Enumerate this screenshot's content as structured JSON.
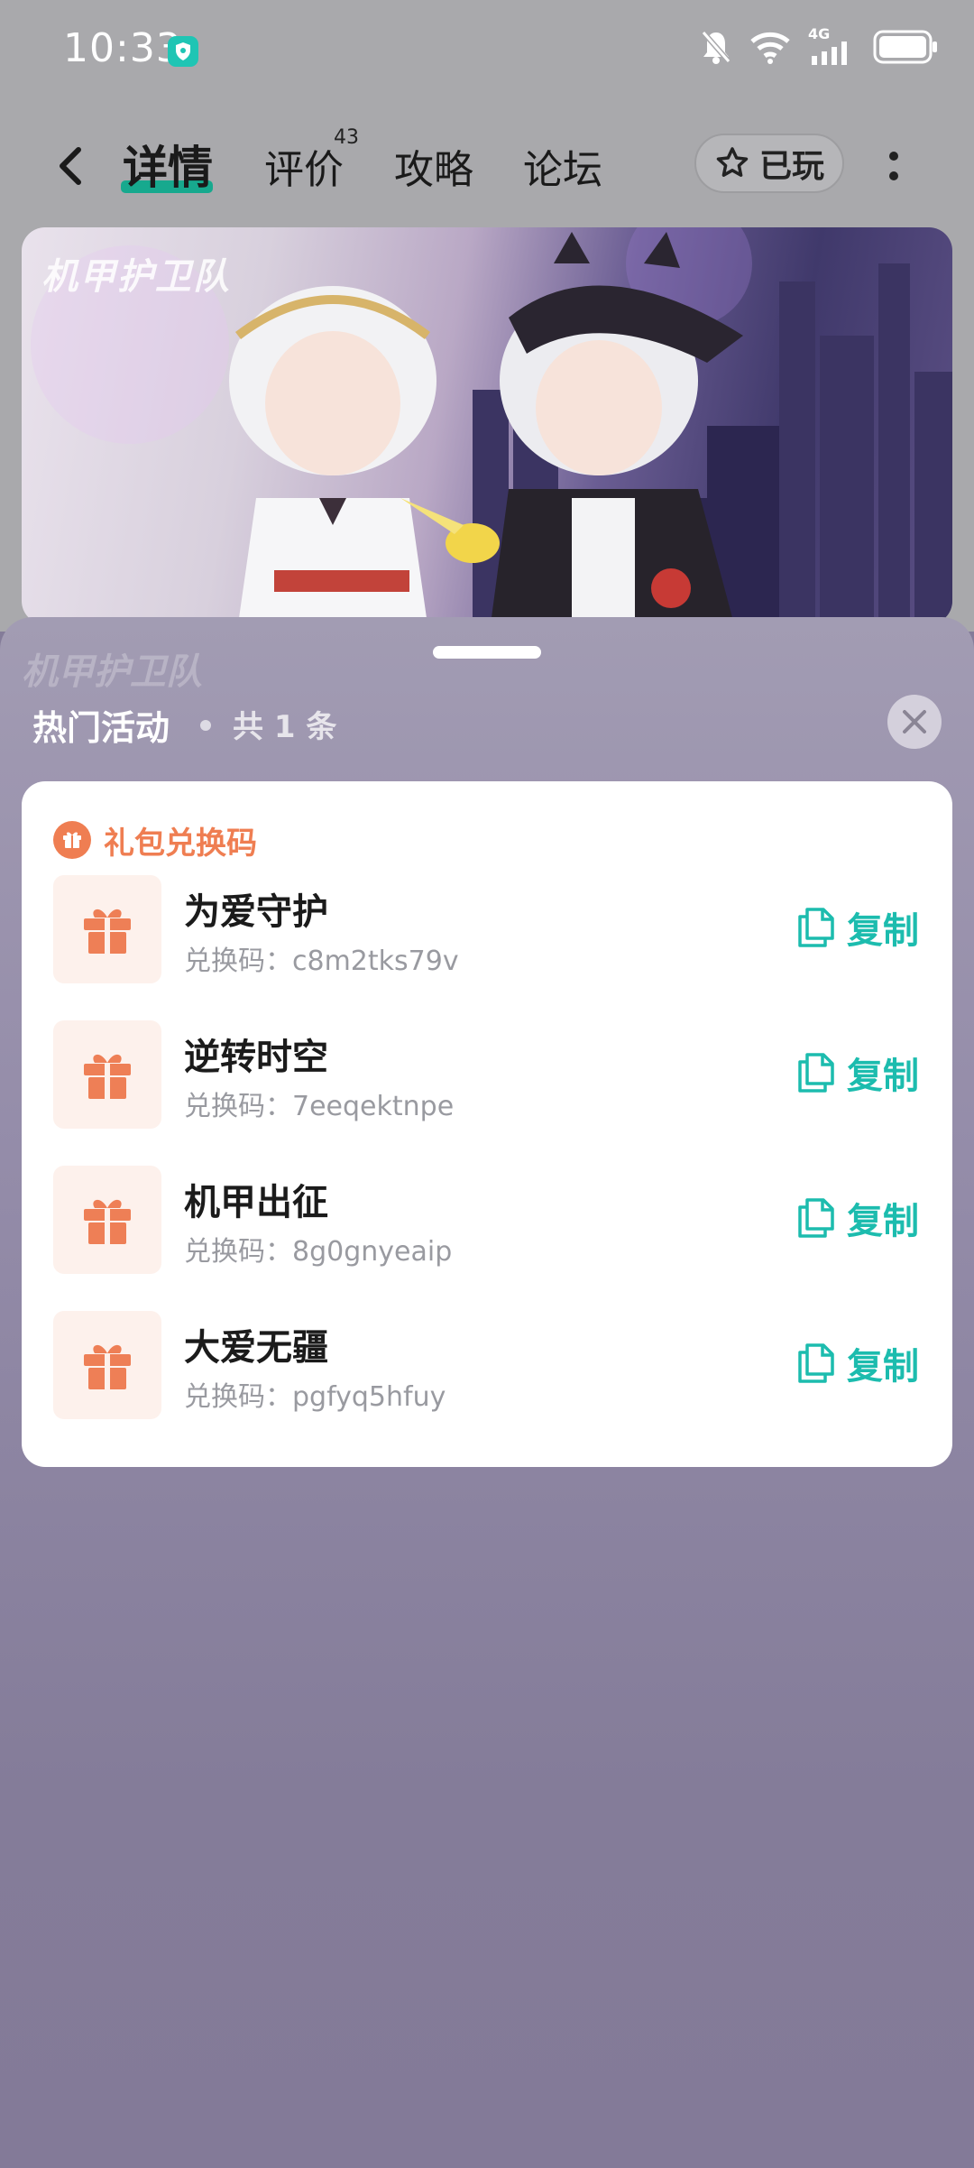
{
  "status_bar": {
    "time": "10:33",
    "network": "4G"
  },
  "nav": {
    "tabs": [
      {
        "label": "详情",
        "active": true
      },
      {
        "label": "评价",
        "count": "43"
      },
      {
        "label": "攻略"
      },
      {
        "label": "论坛"
      }
    ],
    "played_label": "已玩"
  },
  "banner": {
    "logo_text": "机甲护卫队"
  },
  "sheet": {
    "title": "热门活动",
    "count_label": "共 1 条",
    "card": {
      "title": "礼包兑换码",
      "items": [
        {
          "name": "为爱守护",
          "code_prefix": "兑换码：",
          "code": "c8m2tks79v",
          "copy_label": "复制"
        },
        {
          "name": "逆转时空",
          "code_prefix": "兑换码：",
          "code": "7eeqektnpe",
          "copy_label": "复制"
        },
        {
          "name": "机甲出征",
          "code_prefix": "兑换码：",
          "code": "8g0gnyeaip",
          "copy_label": "复制"
        },
        {
          "name": "大爱无疆",
          "code_prefix": "兑换码：",
          "code": "pgfyq5hfuy",
          "copy_label": "复制"
        }
      ]
    }
  },
  "colors": {
    "accent_orange": "#ef7e52",
    "accent_teal": "#1cbcae",
    "tab_underline": "#17a98e"
  }
}
